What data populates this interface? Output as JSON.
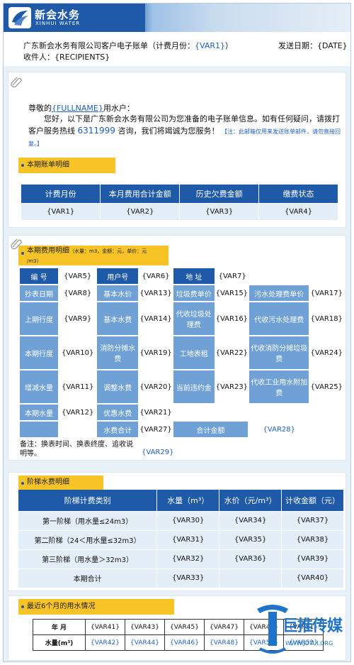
{
  "brand": {
    "cn": "新会水务",
    "en": "XINHUI WATER"
  },
  "header": {
    "title_prefix": "广东新会水务有限公司客户电子账单（计费月份：",
    "title_var": "{VAR1}",
    "title_suffix": "）",
    "send_date": "发送日期：{DATE}",
    "recipients": "收件人：{RECIPIENTS}"
  },
  "greeting": {
    "salute_pre": "尊敬的",
    "fullname": "{FULLNAME}",
    "salute_post": "用水户：",
    "body_1": "您好，以下是广东新会水务有限公司为您准备的电子账单信息。如有任何疑问，请拨打客户服务热线",
    "hotline": "6311999",
    "body_2": "咨询，我们将竭诚为您服务！",
    "note": "【注：此邮箱仅用来发送账单邮件，请勿直接回复。】"
  },
  "summary": {
    "pill": "本期账单明细",
    "headers": [
      "计费月份",
      "本月费用合计金额",
      "历史欠费金额",
      "缴费状态"
    ],
    "values": [
      "{VAR1}",
      "{VAR2}",
      "{VAR3}",
      "{VAR4}"
    ]
  },
  "detail": {
    "pill_main": "本期费用明细",
    "pill_unit1": "（水量：m3，金额：元，单价：元",
    "pill_unit2": "/m3）",
    "num_label": "编  号",
    "num_val": "{VAR5}",
    "user_label": "用户号",
    "user_val": "{VAR6}",
    "addr_label": "地  址",
    "addr_val": "{VAR7}",
    "rows": [
      [
        "抄表日期",
        "{VAR8}",
        "基本水价",
        "{VAR13}",
        "垃圾费单价",
        "{VAR15}",
        "污水处理费单价",
        "{VAR17}"
      ],
      [
        "上期行度",
        "{VAR9}",
        "基本水费",
        "{VAR14}",
        "代收垃圾处理费",
        "{VAR16}",
        "代收污水处理费",
        "{VAR18}"
      ],
      [
        "本期行度",
        "{VAR10}",
        "消防分摊水费",
        "{VAR19}",
        "工地表租",
        "{VAR22}",
        "代收消防分摊垃圾费",
        "{VAR24}"
      ],
      [
        "增减水量",
        "{VAR11}",
        "调整水费",
        "{VAR20}",
        "当前违约金",
        "{VAR23}",
        "代收工业用水附加费",
        "{VAR25}"
      ]
    ],
    "this_water_label": "本期水量",
    "this_water_val": "{VAR12}",
    "discount_label": "优惠水费",
    "discount_val": "{VAR21}",
    "water_total_label": "水费合计",
    "water_total_val": "{VAR27}",
    "grand_label": "合计金额",
    "grand_val": "{VAR28}",
    "remark": "备注：换表时间、换表终度、追收说明等。",
    "remark_val": "{VAR29}"
  },
  "tier": {
    "pill": "阶梯水费明细",
    "headers": [
      "阶梯计费类别",
      "水量（m³）",
      "水价（元/m³）",
      "计收金额（元）"
    ],
    "rows": [
      [
        "第一阶梯（用水量≤24m3）",
        "{VAR30}",
        "{VAR34}",
        "{VAR37}"
      ],
      [
        "第二阶梯（24＜用水量≤32m3）",
        "{VAR31}",
        "{VAR35}",
        "{VAR38}"
      ],
      [
        "第三阶梯（用水量＞32m3）",
        "{VAR32}",
        "{VAR36}",
        "{VAR39}"
      ],
      [
        "本期合计",
        "{VAR33}",
        "",
        "{VAR40}"
      ]
    ]
  },
  "history": {
    "pill": "最近6个月的用水情况",
    "month_label": "年  月",
    "water_label": "水量(m³)",
    "months": [
      "{VAR41}",
      "{VAR43}",
      "{VAR45}",
      "{VAR47}",
      "{VAR49}",
      "{VAR51}"
    ],
    "waters": [
      "{VAR42}",
      "{VAR44}",
      "{VAR46}",
      "{VAR48}",
      "{VAR50}",
      "{VAR52}"
    ]
  },
  "watermark": {
    "cn": "巨推传媒",
    "url": "WWW.JUTUI.ORG"
  },
  "colors": {
    "primary": "#1f5aa8",
    "light": "#6fa0d6",
    "cell": "#e4eef8",
    "pill": "#f7c326",
    "link": "#1f5fbf"
  }
}
